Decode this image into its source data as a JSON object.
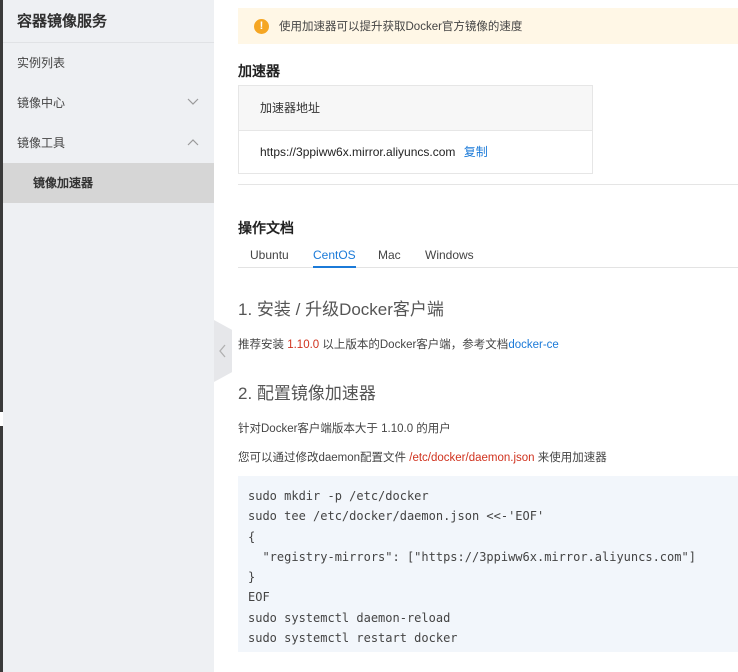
{
  "sidebar": {
    "title": "容器镜像服务",
    "items": [
      {
        "label": "实例列表"
      },
      {
        "label": "镜像中心"
      },
      {
        "label": "镜像工具"
      }
    ],
    "sub_item": "镜像加速器"
  },
  "notice": {
    "icon": "!",
    "text": "使用加速器可以提升获取Docker官方镜像的速度"
  },
  "accelerator": {
    "section_title": "加速器",
    "header": "加速器地址",
    "address": "https://3ppiww6x.mirror.aliyuncs.com",
    "copy_label": "复制"
  },
  "docs": {
    "section_title": "操作文档",
    "tabs": [
      "Ubuntu",
      "CentOS",
      "Mac",
      "Windows"
    ],
    "active_tab": "CentOS",
    "step1_title": "1. 安装 / 升级Docker客户端",
    "step1_text_pre": "推荐安装 ",
    "step1_version": "1.10.0",
    "step1_text_mid": " 以上版本的Docker客户端，参考文档",
    "step1_link": "docker-ce",
    "step2_title": "2. 配置镜像加速器",
    "step2_line1": "针对Docker客户端版本大于 1.10.0 的用户",
    "step2_line2_pre": "您可以通过修改daemon配置文件 ",
    "step2_path": "/etc/docker/daemon.json",
    "step2_line2_post": " 来使用加速器",
    "code_lines": [
      "sudo mkdir -p /etc/docker",
      "sudo tee /etc/docker/daemon.json <<-'EOF'",
      "{",
      "  \"registry-mirrors\": [\"https://3ppiww6x.mirror.aliyuncs.com\"]",
      "}",
      "EOF",
      "sudo systemctl daemon-reload",
      "sudo systemctl restart docker"
    ]
  },
  "colors": {
    "accent": "#1b7ad8",
    "warning": "#f5a623",
    "highlight_red": "#d0321e",
    "sidebar_bg": "#eef0f3"
  }
}
